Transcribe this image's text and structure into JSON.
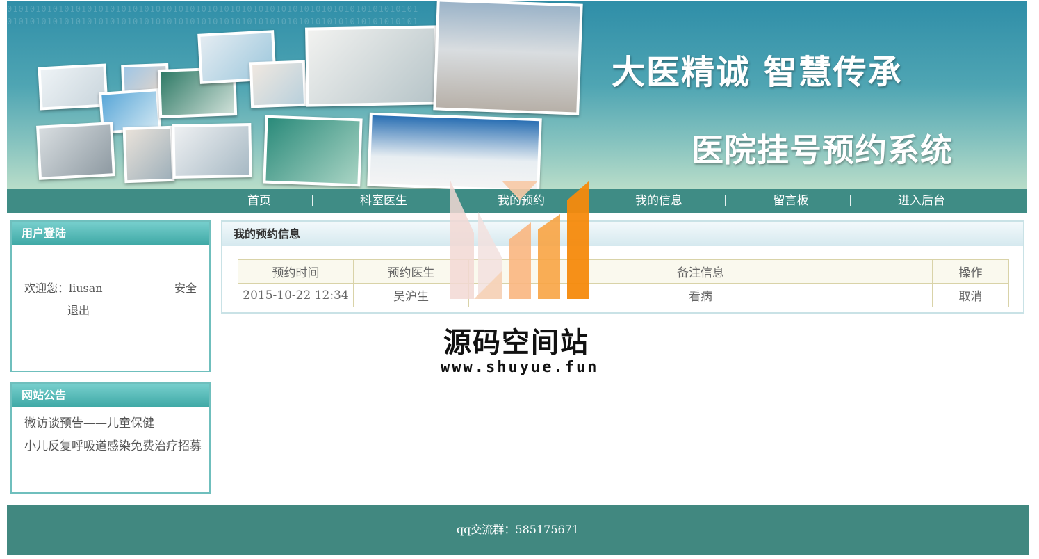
{
  "banner": {
    "slogan_line1": "大医精诚  智慧传承",
    "slogan_line2": "医院挂号预约系统",
    "binary_pattern": "010101010101010101010101010101010101010101010101010101010101010101010101"
  },
  "nav": {
    "items": [
      {
        "label": "首页"
      },
      {
        "label": "科室医生"
      },
      {
        "label": "我的预约"
      },
      {
        "label": "我的信息"
      },
      {
        "label": "留言板"
      },
      {
        "label": "进入后台"
      }
    ]
  },
  "login": {
    "title": "用户登陆",
    "welcome": "欢迎您：liusan",
    "security": "安全",
    "logout": "退出"
  },
  "notice": {
    "title": "网站公告",
    "items": [
      {
        "text": "微访谈预告——儿童保健"
      },
      {
        "text": "小儿反复呼吸道感染免费治疗招募"
      }
    ]
  },
  "appointments": {
    "title": "我的预约信息",
    "columns": [
      "预约时间",
      "预约医生",
      "备注信息",
      "操作"
    ],
    "rows": [
      {
        "time": "2015-10-22 12:34",
        "doctor": "吴沪生",
        "note": "看病",
        "action": "取消"
      }
    ]
  },
  "watermark": {
    "name": "源码空间站",
    "url": "www.shuyue.fun"
  },
  "footer": {
    "text": "qq交流群：585175671"
  },
  "colors": {
    "nav_bg": "#3f8c85",
    "box_border": "#6fbfbd",
    "footer_bg": "#418880"
  }
}
